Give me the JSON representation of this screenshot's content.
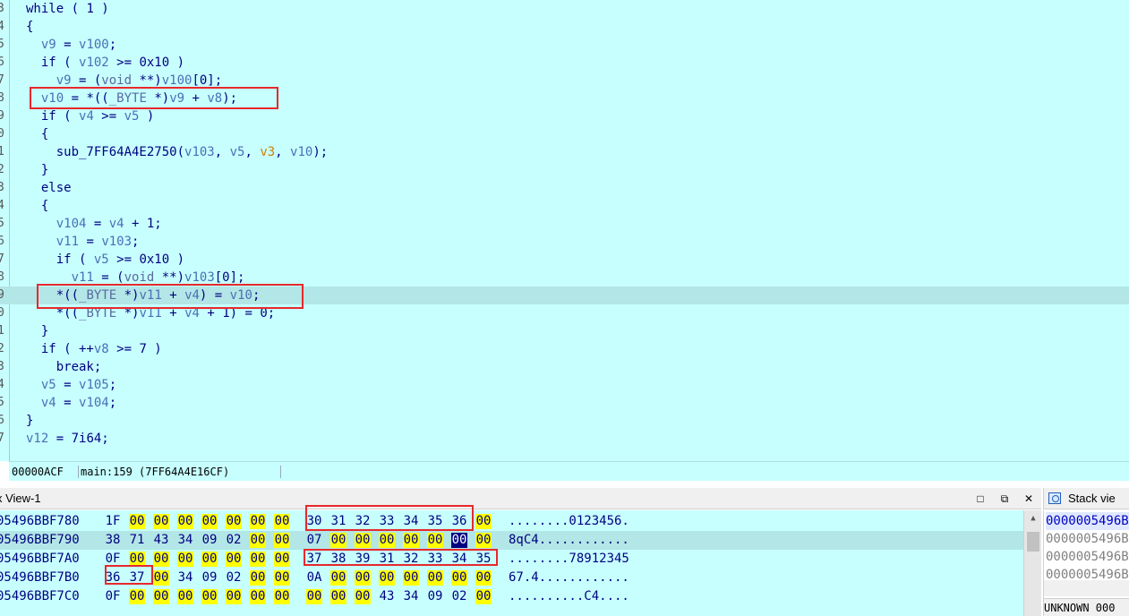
{
  "code": {
    "lines": [
      {
        "num": "3",
        "text": "while ( 1 )"
      },
      {
        "num": "4",
        "text": "{"
      },
      {
        "num": "5",
        "text": "  v9 = v100;"
      },
      {
        "num": "6",
        "text": "  if ( v102 >= 0x10 )"
      },
      {
        "num": "7",
        "text": "    v9 = (void **)v100[0];"
      },
      {
        "num": "8",
        "text": "  v10 = *((_BYTE *)v9 + v8);"
      },
      {
        "num": "9",
        "text": "  if ( v4 >= v5 )"
      },
      {
        "num": "0",
        "text": "  {"
      },
      {
        "num": "1",
        "text": "    sub_7FF64A4E2750(v103, v5, v3, v10);"
      },
      {
        "num": "2",
        "text": "  }"
      },
      {
        "num": "3",
        "text": "  else"
      },
      {
        "num": "4",
        "text": "  {"
      },
      {
        "num": "5",
        "text": "    v104 = v4 + 1;"
      },
      {
        "num": "6",
        "text": "    v11 = v103;"
      },
      {
        "num": "7",
        "text": "    if ( v5 >= 0x10 )"
      },
      {
        "num": "8",
        "text": "      v11 = (void **)v103[0];"
      },
      {
        "num": "9",
        "text": "    *((_BYTE *)v11 + v4) = v10;"
      },
      {
        "num": "0",
        "text": "    *((_BYTE *)v11 + v4 + 1) = 0;"
      },
      {
        "num": "1",
        "text": "  }"
      },
      {
        "num": "2",
        "text": "  if ( ++v8 >= 7 )"
      },
      {
        "num": "3",
        "text": "    break;"
      },
      {
        "num": "4",
        "text": "  v5 = v105;"
      },
      {
        "num": "5",
        "text": "  v4 = v104;"
      },
      {
        "num": "6",
        "text": "}"
      },
      {
        "num": "7",
        "text": "v12 = 7i64;"
      }
    ]
  },
  "status": {
    "offset": "00000ACF",
    "location": "main:159 (7FF64A4E16CF)"
  },
  "hex_view": {
    "title": "x View-1",
    "rows": [
      {
        "addr": "05496BBF780",
        "bytes": [
          "1F",
          "00",
          "00",
          "00",
          "00",
          "00",
          "00",
          "00",
          "30",
          "31",
          "32",
          "33",
          "34",
          "35",
          "36",
          "00"
        ],
        "ascii": "........0123456."
      },
      {
        "addr": "05496BBF790",
        "bytes": [
          "38",
          "71",
          "43",
          "34",
          "09",
          "02",
          "00",
          "00",
          "07",
          "00",
          "00",
          "00",
          "00",
          "00",
          "00",
          "00"
        ],
        "ascii": "8qC4............"
      },
      {
        "addr": "05496BBF7A0",
        "bytes": [
          "0F",
          "00",
          "00",
          "00",
          "00",
          "00",
          "00",
          "00",
          "37",
          "38",
          "39",
          "31",
          "32",
          "33",
          "34",
          "35"
        ],
        "ascii": "........78912345"
      },
      {
        "addr": "05496BBF7B0",
        "bytes": [
          "36",
          "37",
          "00",
          "34",
          "09",
          "02",
          "00",
          "00",
          "0A",
          "00",
          "00",
          "00",
          "00",
          "00",
          "00",
          "00"
        ],
        "ascii": "67.4............"
      },
      {
        "addr": "05496BBF7C0",
        "bytes": [
          "0F",
          "00",
          "00",
          "00",
          "00",
          "00",
          "00",
          "00",
          "00",
          "00",
          "00",
          "43",
          "34",
          "09",
          "02",
          "00",
          "00"
        ],
        "ascii": "..........C4...."
      }
    ]
  },
  "stack_view": {
    "title": "Stack vie",
    "rows": [
      "0000005496B",
      "0000005496B",
      "0000005496B",
      "0000005496B"
    ],
    "status": "UNKNOWN 000"
  },
  "icons": {
    "maximize": "maximize-icon",
    "float": "float-window-icon",
    "close": "close-icon",
    "stack": "stack-view-icon"
  }
}
